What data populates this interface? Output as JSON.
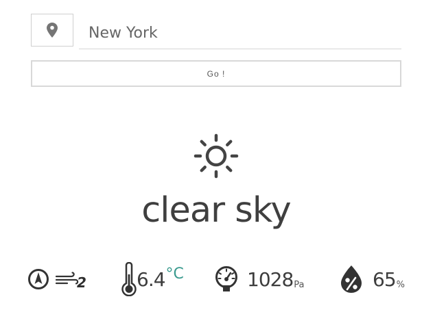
{
  "search": {
    "location_icon": "map-pin-icon",
    "city_value": "New York",
    "go_label": "Go !"
  },
  "weather": {
    "icon": "sun-icon",
    "condition": "clear sky"
  },
  "stats": {
    "wind_direction_icon": "compass-arrow-icon",
    "wind_icon": "wind-icon",
    "wind_speed": "2",
    "temperature_icon": "thermometer-icon",
    "temperature": "6.4",
    "temperature_unit": "°C",
    "pressure_icon": "gauge-icon",
    "pressure": "1028",
    "pressure_unit": "Pa",
    "humidity_icon": "humidity-drop-icon",
    "humidity": "65",
    "humidity_unit": "%"
  },
  "colors": {
    "accent": "#3a9a8e",
    "text": "#3f3f3f",
    "border": "#d8d8d8"
  }
}
